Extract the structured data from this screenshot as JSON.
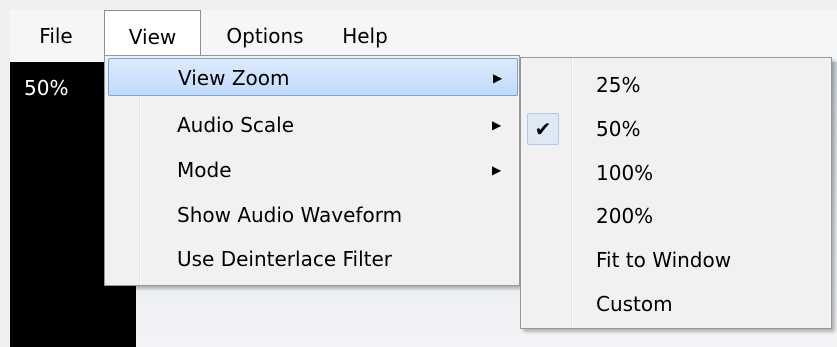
{
  "menubar": {
    "items": [
      {
        "label": "File"
      },
      {
        "label": "View"
      },
      {
        "label": "Options"
      },
      {
        "label": "Help"
      }
    ]
  },
  "left_panel": {
    "zoom_readout": "50%"
  },
  "view_menu": {
    "items": [
      {
        "label": "View Zoom",
        "submenu_arrow": "▶"
      },
      {
        "label": "Audio Scale",
        "submenu_arrow": "▶"
      },
      {
        "label": "Mode",
        "submenu_arrow": "▶"
      },
      {
        "label": "Show Audio Waveform"
      },
      {
        "label": "Use Deinterlace Filter"
      }
    ]
  },
  "zoom_submenu": {
    "checkmark": "✔",
    "items": [
      {
        "label": "25%",
        "checked": false
      },
      {
        "label": "50%",
        "checked": true
      },
      {
        "label": "100%",
        "checked": false
      },
      {
        "label": "200%",
        "checked": false
      },
      {
        "label": "Fit to Window",
        "checked": false
      },
      {
        "label": "Custom",
        "checked": false
      }
    ]
  },
  "colors": {
    "highlight_border": "#7da2ce",
    "highlight_fill": "#c1dbfc",
    "panel_black": "#000000"
  }
}
